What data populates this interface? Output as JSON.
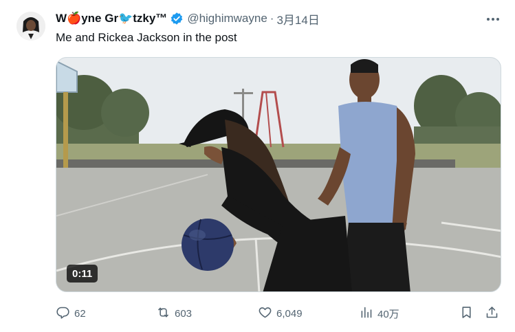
{
  "tweet": {
    "author_name": "W🍎yne Gr🐦tzky™",
    "handle": "@highimwayne",
    "separator": "·",
    "timestamp": "3月14日",
    "text": "Me and Rickea Jackson in the post"
  },
  "media": {
    "type": "video",
    "duration": "0:11"
  },
  "actions": {
    "reply_count": "62",
    "retweet_count": "603",
    "like_count": "6,049",
    "view_count": "40万"
  },
  "icons": {
    "verified": "verified-badge-icon",
    "more": "more-icon",
    "reply": "reply-icon",
    "retweet": "retweet-icon",
    "like": "heart-icon",
    "views": "views-icon",
    "bookmark": "bookmark-icon",
    "share": "share-icon"
  },
  "colors": {
    "verified_blue": "#1d9bf0",
    "secondary_text": "#536471",
    "primary_text": "#0f1419"
  }
}
